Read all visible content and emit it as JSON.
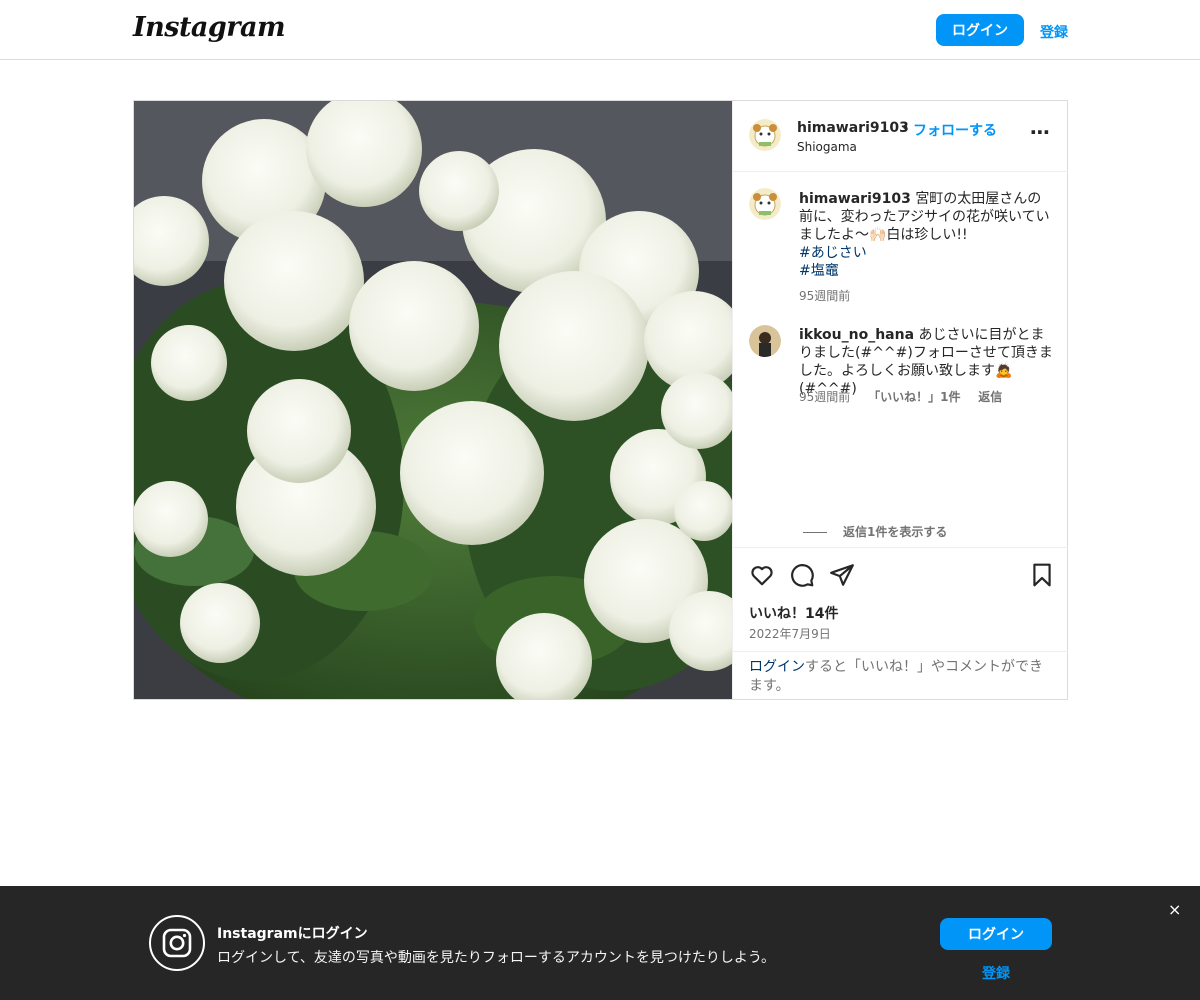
{
  "header": {
    "logo_text": "Instagram",
    "login_label": "ログイン",
    "signup_label": "登録"
  },
  "post": {
    "author": {
      "username": "himawari9103",
      "follow_label": "フォローする",
      "location": "Shiogama"
    },
    "caption": {
      "username": "himawari9103",
      "text": "宮町の太田屋さんの前に、変わったアジサイの花が咲いていましたよ〜🙌🏻白は珍しい!!",
      "hashtags": [
        "#あじさい",
        "#塩竈"
      ],
      "time": "95週間前"
    },
    "comments": [
      {
        "username": "ikkou_no_hana",
        "text": "あじさいに目がとまりました(#^^#)フォローさせて頂きました。よろしくお願い致します🙇(#^^#)",
        "time": "95週間前",
        "likes": "「いいね！」1件",
        "reply_label": "返信"
      }
    ],
    "view_replies_label": "返信1件を表示する",
    "likes_label": "いいね！14件",
    "date": "2022年7月9日",
    "login_note": {
      "link": "ログイン",
      "rest": "すると「いいね！」やコメントができます。"
    },
    "icons": {
      "like": "heart-icon",
      "comment": "comment-icon",
      "share": "paper-plane-icon",
      "save": "bookmark-icon",
      "more": "more-options-icon"
    }
  },
  "banner": {
    "title": "Instagramにログイン",
    "subtitle": "ログインして、友達の写真や動画を見たりフォローするアカウントを見つけたりしよう。",
    "login_label": "ログイン",
    "signup_label": "登録",
    "close_label": "×"
  },
  "colors": {
    "accent": "#0095f6",
    "link_dark": "#00376b",
    "banner_bg": "#262626",
    "border": "#dbdbdb"
  }
}
